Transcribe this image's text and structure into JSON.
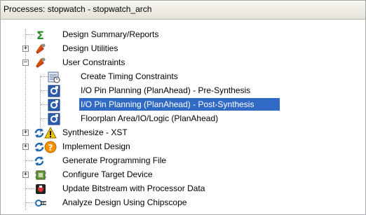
{
  "panel": {
    "title": "Processes: stopwatch - stopwatch_arch"
  },
  "tree": {
    "items": [
      {
        "label": "Design Summary/Reports",
        "icon": "sigma-icon",
        "expander": ""
      },
      {
        "label": "Design Utilities",
        "icon": "tools-icon",
        "expander": "+"
      },
      {
        "label": "User Constraints",
        "icon": "tools-icon",
        "expander": "−"
      },
      {
        "label": "Create Timing Constraints",
        "icon": "timing-constraints-icon",
        "expander": ""
      },
      {
        "label": "I/O Pin Planning (PlanAhead) - Pre-Synthesis",
        "icon": "planahead-icon",
        "expander": ""
      },
      {
        "label": "I/O Pin Planning (PlanAhead) - Post-Synthesis",
        "icon": "planahead-icon",
        "expander": "",
        "selected": true
      },
      {
        "label": "Floorplan Area/IO/Logic (PlanAhead)",
        "icon": "planahead-icon",
        "expander": ""
      },
      {
        "label": "Synthesize - XST",
        "icon": "warning-status-icon",
        "expander": "+"
      },
      {
        "label": "Implement Design",
        "icon": "question-status-icon",
        "expander": "+"
      },
      {
        "label": "Generate Programming File",
        "icon": "run-icon",
        "expander": ""
      },
      {
        "label": "Configure Target Device",
        "icon": "device-icon",
        "expander": "+"
      },
      {
        "label": "Update Bitstream with Processor Data",
        "icon": "bitstream-icon",
        "expander": ""
      },
      {
        "label": "Analyze Design Using Chipscope",
        "icon": "chipscope-icon",
        "expander": ""
      }
    ]
  },
  "colors": {
    "selection": "#316ac5",
    "header_bg": "#ece9d8"
  }
}
